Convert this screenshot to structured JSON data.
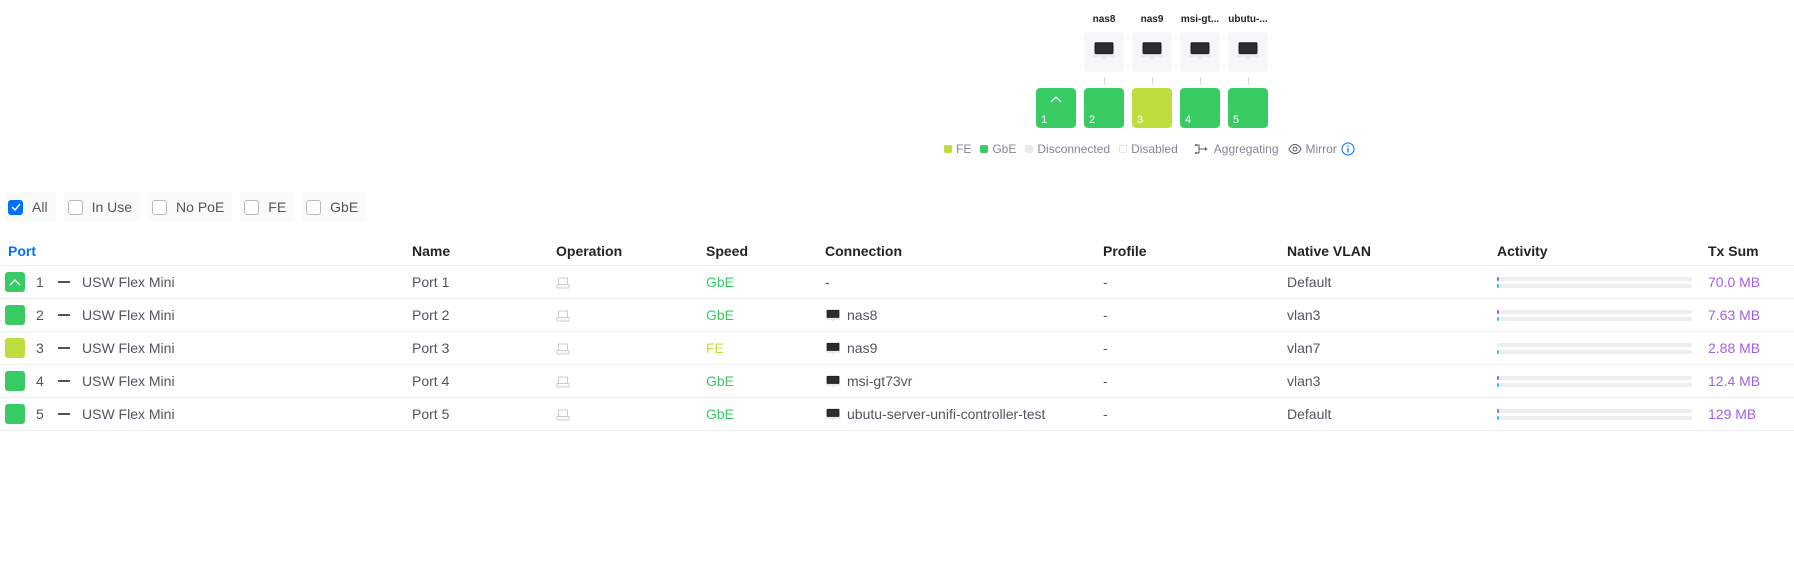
{
  "colors": {
    "gbe": "#38cb64",
    "fe": "#bede3e",
    "disconnected": "#e8e9ec",
    "disabled": "#ffffff",
    "accent": "#006fff",
    "tx": "#a45ee5",
    "rx": "#3ec3f0"
  },
  "diagram": {
    "devices": [
      {
        "port": 2,
        "label": "nas8",
        "icon": "laptop-icon"
      },
      {
        "port": 3,
        "label": "nas9",
        "icon": "laptop-icon"
      },
      {
        "port": 4,
        "label": "msi-gt...",
        "icon": "laptop-icon"
      },
      {
        "port": 5,
        "label": "ubutu-...",
        "icon": "laptop-icon"
      }
    ],
    "ports": [
      {
        "number": "1",
        "speed": "GbE",
        "uplink": true
      },
      {
        "number": "2",
        "speed": "GbE",
        "uplink": false
      },
      {
        "number": "3",
        "speed": "FE",
        "uplink": false
      },
      {
        "number": "4",
        "speed": "GbE",
        "uplink": false
      },
      {
        "number": "5",
        "speed": "GbE",
        "uplink": false
      }
    ]
  },
  "legend": {
    "fe": "FE",
    "gbe": "GbE",
    "disconnected": "Disconnected",
    "disabled": "Disabled",
    "aggregating": "Aggregating",
    "mirror": "Mirror"
  },
  "filters": [
    {
      "label": "All",
      "checked": true
    },
    {
      "label": "In Use",
      "checked": false
    },
    {
      "label": "No PoE",
      "checked": false
    },
    {
      "label": "FE",
      "checked": false
    },
    {
      "label": "GbE",
      "checked": false
    }
  ],
  "table": {
    "columns": {
      "port": "Port",
      "name": "Name",
      "operation": "Operation",
      "speed": "Speed",
      "connection": "Connection",
      "profile": "Profile",
      "native_vlan": "Native VLAN",
      "activity": "Activity",
      "tx_sum": "Tx Sum"
    },
    "rows": [
      {
        "port": "1",
        "device": "USW Flex Mini",
        "name": "Port 1",
        "speed": "GbE",
        "connection": "-",
        "has_client": false,
        "profile": "-",
        "vlan": "Default",
        "tx_activity": 0.01,
        "rx_activity": 0.01,
        "tx_sum": "70.0 MB",
        "uplink": true
      },
      {
        "port": "2",
        "device": "USW Flex Mini",
        "name": "Port 2",
        "speed": "GbE",
        "connection": "nas8",
        "has_client": true,
        "profile": "-",
        "vlan": "vlan3",
        "tx_activity": 0.01,
        "rx_activity": 0.01,
        "tx_sum": "7.63 MB",
        "uplink": false
      },
      {
        "port": "3",
        "device": "USW Flex Mini",
        "name": "Port 3",
        "speed": "FE",
        "connection": "nas9",
        "has_client": true,
        "profile": "-",
        "vlan": "vlan7",
        "tx_activity": 0,
        "rx_activity": 0.01,
        "tx_sum": "2.88 MB",
        "uplink": false
      },
      {
        "port": "4",
        "device": "USW Flex Mini",
        "name": "Port 4",
        "speed": "GbE",
        "connection": "msi-gt73vr",
        "has_client": true,
        "profile": "-",
        "vlan": "vlan3",
        "tx_activity": 0.01,
        "rx_activity": 0.01,
        "tx_sum": "12.4 MB",
        "uplink": false
      },
      {
        "port": "5",
        "device": "USW Flex Mini",
        "name": "Port 5",
        "speed": "GbE",
        "connection": "ubutu-server-unifi-controller-test",
        "has_client": true,
        "profile": "-",
        "vlan": "Default",
        "tx_activity": 0.01,
        "rx_activity": 0.01,
        "tx_sum": "129 MB",
        "uplink": false
      }
    ]
  }
}
